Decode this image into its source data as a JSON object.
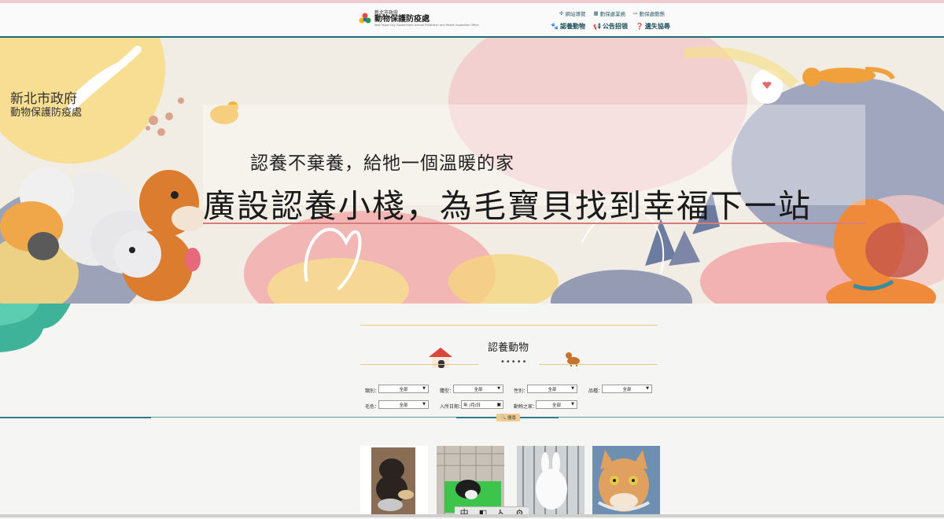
{
  "header": {
    "logo_small": "新北市政府",
    "logo_main": "動物保護防疫處",
    "logo_en": "New Taipei City Government Animal Protection and Health Inspection Office",
    "utility_links": [
      {
        "icon": "sitemap-icon",
        "label": "網站導覽"
      },
      {
        "icon": "building-icon",
        "label": "動保處業務"
      },
      {
        "icon": "arrow-icon",
        "label": "動保處動態"
      }
    ],
    "main_nav": [
      {
        "icon": "paw-icon",
        "label": "認養動物"
      },
      {
        "icon": "megaphone-icon",
        "label": "公告招領"
      },
      {
        "icon": "question-icon",
        "label": "遺失協尋"
      }
    ]
  },
  "banner": {
    "org_line1": "新北市政府",
    "org_line2": "動物保護防疫處",
    "subtitle": "認養不棄養，給牠一個溫暖的家",
    "title": "廣設認養小棧，為毛寶貝找到幸福下一站"
  },
  "section": {
    "title": "認養動物",
    "dots": "•••••"
  },
  "filters": [
    {
      "label": "類別：",
      "value": "全部"
    },
    {
      "label": "體型：",
      "value": "全部"
    },
    {
      "label": "性別：",
      "value": "全部"
    },
    {
      "label": "品種：",
      "value": "全部"
    },
    {
      "label": "毛色：",
      "value": "全部"
    },
    {
      "label": "入所日期：",
      "value": "年 /月/日"
    },
    {
      "label": "動物之家：",
      "value": "全部"
    }
  ],
  "search_label": "搜尋",
  "tools": [
    "中",
    "◧",
    "♿",
    "⚙"
  ],
  "colors": {
    "accent_teal": "#1f6b75",
    "accent_gold": "#e6c98a",
    "banner_line": "#d97b7b"
  }
}
